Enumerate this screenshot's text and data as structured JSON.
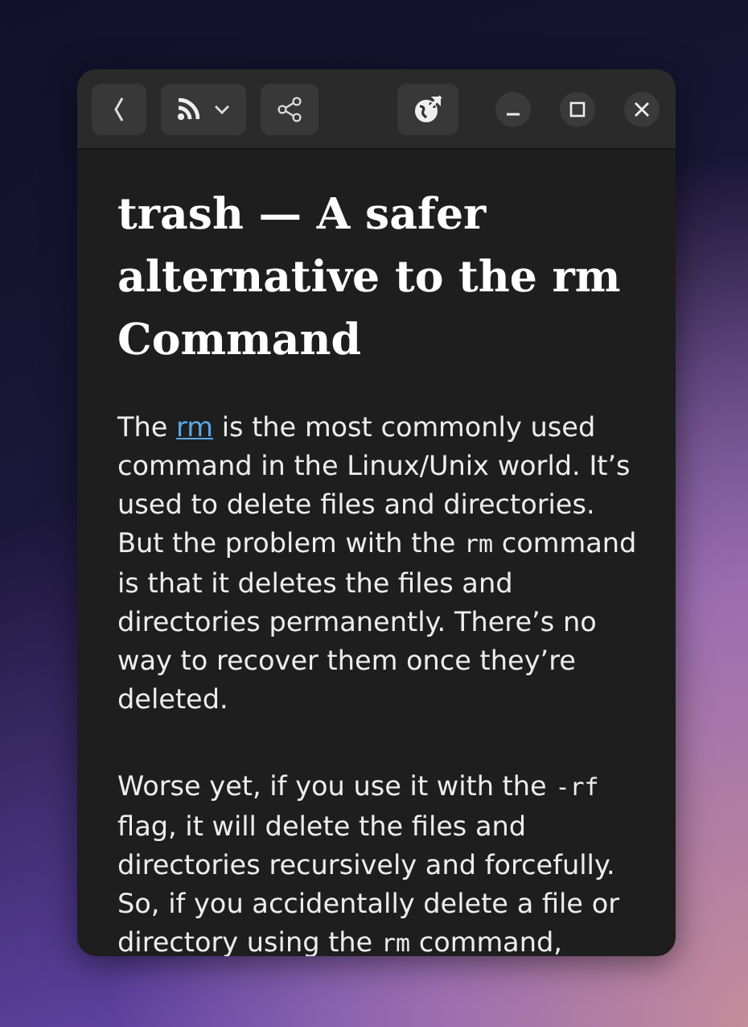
{
  "header": {
    "buttons": [
      {
        "kind": "back"
      },
      {
        "kind": "feed"
      },
      {
        "kind": "share"
      }
    ],
    "end_buttons": [
      {
        "kind": "browser"
      }
    ],
    "window_controls": [
      {
        "kind": "minimize"
      },
      {
        "kind": "maximize"
      },
      {
        "kind": "close"
      }
    ]
  },
  "article": {
    "title": "trash — A safer alternative to the rm Command",
    "paragraphs": [
      [
        {
          "kind": "text",
          "text": "The "
        },
        {
          "kind": "link",
          "text": "rm"
        },
        {
          "kind": "text",
          "text": " is the most commonly used command in the Linux/Unix world. It’s used to delete files and directories. But the problem with the "
        },
        {
          "kind": "code",
          "text": "rm"
        },
        {
          "kind": "text",
          "text": " command is that it deletes the files and directories permanently. There’s no way to recover them once they’re deleted."
        }
      ],
      [
        {
          "kind": "text",
          "text": "Worse yet, if you use it with the "
        },
        {
          "kind": "code",
          "text": "-rf"
        },
        {
          "kind": "text",
          "text": " flag, it will delete the files and directories recursively and forcefully. So, if you accidentally delete a file or directory using the "
        },
        {
          "kind": "code",
          "text": "rm"
        },
        {
          "kind": "text",
          "text": " command,"
        }
      ]
    ]
  }
}
